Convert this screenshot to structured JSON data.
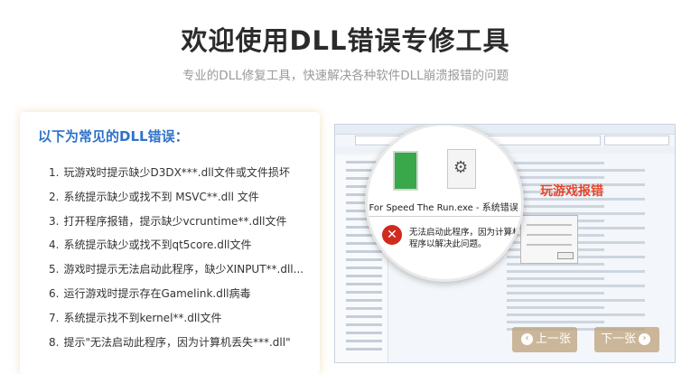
{
  "header": {
    "title": "欢迎使用DLL错误专修工具",
    "subtitle": "专业的DLL修复工具，快速解决各种软件DLL崩溃报错的问题"
  },
  "card": {
    "heading": "以下为常见的DLL错误：",
    "items": [
      {
        "num": "1.",
        "text": "玩游戏时提示缺少D3DX***.dll文件或文件损坏"
      },
      {
        "num": "2.",
        "text": "系统提示缺少或找不到 MSVC**.dll 文件"
      },
      {
        "num": "3.",
        "text": "打开程序报错，提示缺少vcruntime**.dll文件"
      },
      {
        "num": "4.",
        "text": "系统提示缺少或找不到qt5core.dll文件"
      },
      {
        "num": "5.",
        "text": "游戏时提示无法启动此程序，缺少XINPUT**.dll..."
      },
      {
        "num": "6.",
        "text": "运行游戏时提示存在Gamelink.dll病毒"
      },
      {
        "num": "7.",
        "text": "系统提示找不到kernel**.dll文件"
      },
      {
        "num": "8.",
        "text": "提示\"无法启动此程序，因为计算机丢失***.dll\""
      }
    ]
  },
  "screenshot": {
    "caption": "玩游戏报错",
    "dialog_title": "d For Speed The Run.exe - 系统错误",
    "error_line1": "无法启动此程序，因为计算机中",
    "error_line2": "程序以解决此问题。",
    "error_icon": "✕",
    "prev_label": "上一张",
    "next_label": "下一张",
    "prev_arrow": "‹",
    "next_arrow": "›"
  },
  "colors": {
    "accent_blue": "#2f72c8",
    "caption_red": "#e8462b",
    "button_tan": "#bea078"
  }
}
